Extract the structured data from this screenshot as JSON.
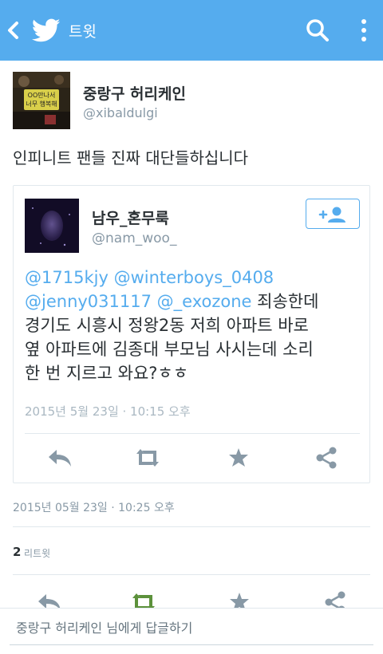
{
  "header": {
    "title": "트윗",
    "back_icon": "chevron-left-icon",
    "logo_icon": "twitter-bird-icon",
    "search_icon": "search-icon",
    "more_icon": "overflow-menu-icon",
    "color": "#55acee"
  },
  "tweet": {
    "author_name": "중랑구 허리케인",
    "author_handle": "@xibaldulgi",
    "text": "인피니트 팬들 진짜 대단들하십니다",
    "timestamp": "2015년 05월 23일 · 10:25 오후",
    "retweet_count": "2",
    "retweet_label": "리트윗"
  },
  "quoted": {
    "author_name": "남우_혼무룩",
    "author_handle": "@nam_woo_",
    "mentions": [
      "@1715kjy",
      "@winterboys_0408",
      "@jenny031117",
      "@_exozone"
    ],
    "text_line1_rest": "죄송한데",
    "text_lines": [
      "경기도 시흥시 정왕2동 저희 아파트 바로",
      "옆 아파트에 김종대 부모님 사시는데 소리",
      "한 번 지르고 와요?ㅎㅎ"
    ],
    "timestamp": "2015년 5월 23일 · 10:15 오후",
    "follow_icon": "add-user-icon"
  },
  "actions": [
    "reply-icon",
    "retweet-icon",
    "favorite-icon",
    "share-icon"
  ],
  "colors": {
    "accent": "#55acee",
    "muted": "#8899a6",
    "icon": "#8899a6",
    "retweeted": "#5c913b"
  },
  "reply_bar": {
    "placeholder": "중랑구 허리케인 님에게 답글하기"
  }
}
